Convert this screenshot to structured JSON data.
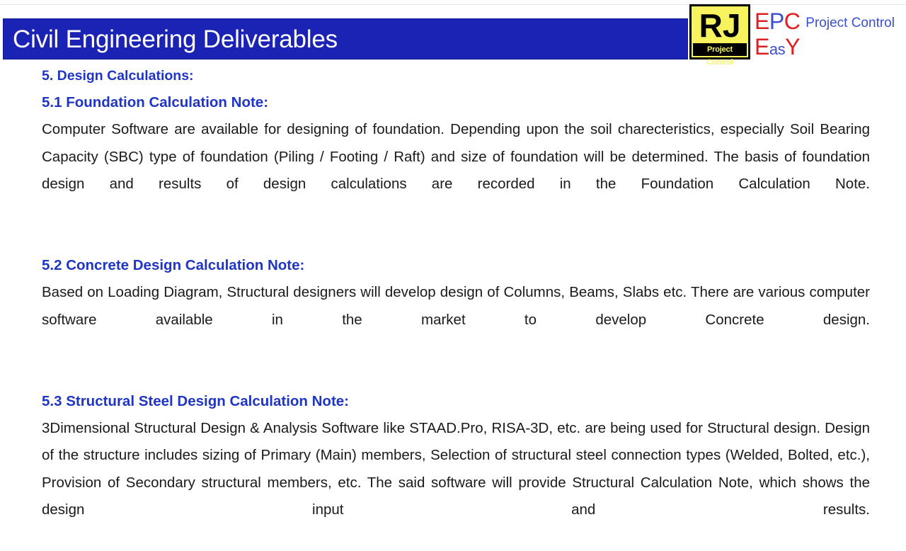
{
  "slide": {
    "title": "Civil Engineering Deliverables",
    "banner_color": "#1a23b4",
    "heading_color": "#1f35c4",
    "body_color": "#1a1a1a"
  },
  "logo": {
    "mark_text": "RJ",
    "mark_subtext": "Project Control",
    "mark_bg": "#f7f35e",
    "epc_e": "E",
    "epc_p": "P",
    "epc_c": "C",
    "tagline": "Project Control",
    "easy_e": "E",
    "easy_as": "as",
    "easy_y": "Y",
    "red": "#e02020",
    "blue": "#3a4fd0"
  },
  "content": {
    "section_heading": "5. Design Calculations:",
    "sections": [
      {
        "heading": "5.1 Foundation Calculation Note:",
        "body": "Computer Software are available for designing of foundation.  Depending upon the soil charecteristics, especially Soil Bearing Capacity (SBC) type of foundation (Piling / Footing / Raft) and size of foundation will be determined.  The basis of foundation design and results of design calculations are recorded in the Foundation Calculation Note."
      },
      {
        "heading": "5.2 Concrete Design Calculation Note:",
        "body": "Based on Loading Diagram, Structural designers will develop design of Columns, Beams, Slabs etc.  There are various computer software available in the market to develop Concrete design."
      },
      {
        "heading": "5.3 Structural Steel Design Calculation Note:",
        "body": "3Dimensional Structural Design & Analysis Software like STAAD.Pro, RISA-3D, etc. are being used for Structural design.  Design of the structure includes sizing of Primary (Main) members, Selection of structural steel connection types (Welded, Bolted, etc.), Provision of Secondary structural members, etc.  The said software will provide Structural Calculation Note, which shows the design input and results."
      }
    ]
  }
}
